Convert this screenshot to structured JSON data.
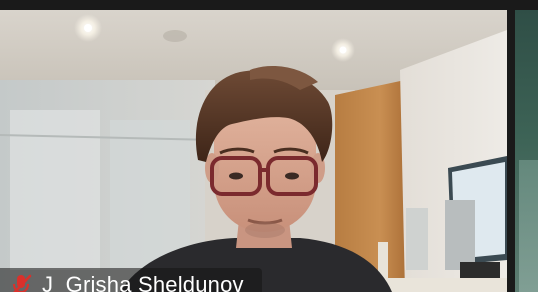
{
  "participant": {
    "name": "J_Grisha Sheldunov",
    "mic_status_icon": "mic-muted-icon",
    "mic_status_color": "#d9302b"
  },
  "colors": {
    "gallery_background": "#1a1a1a",
    "label_background": "rgba(20,20,20,0.55)",
    "label_text": "#ffffff"
  }
}
